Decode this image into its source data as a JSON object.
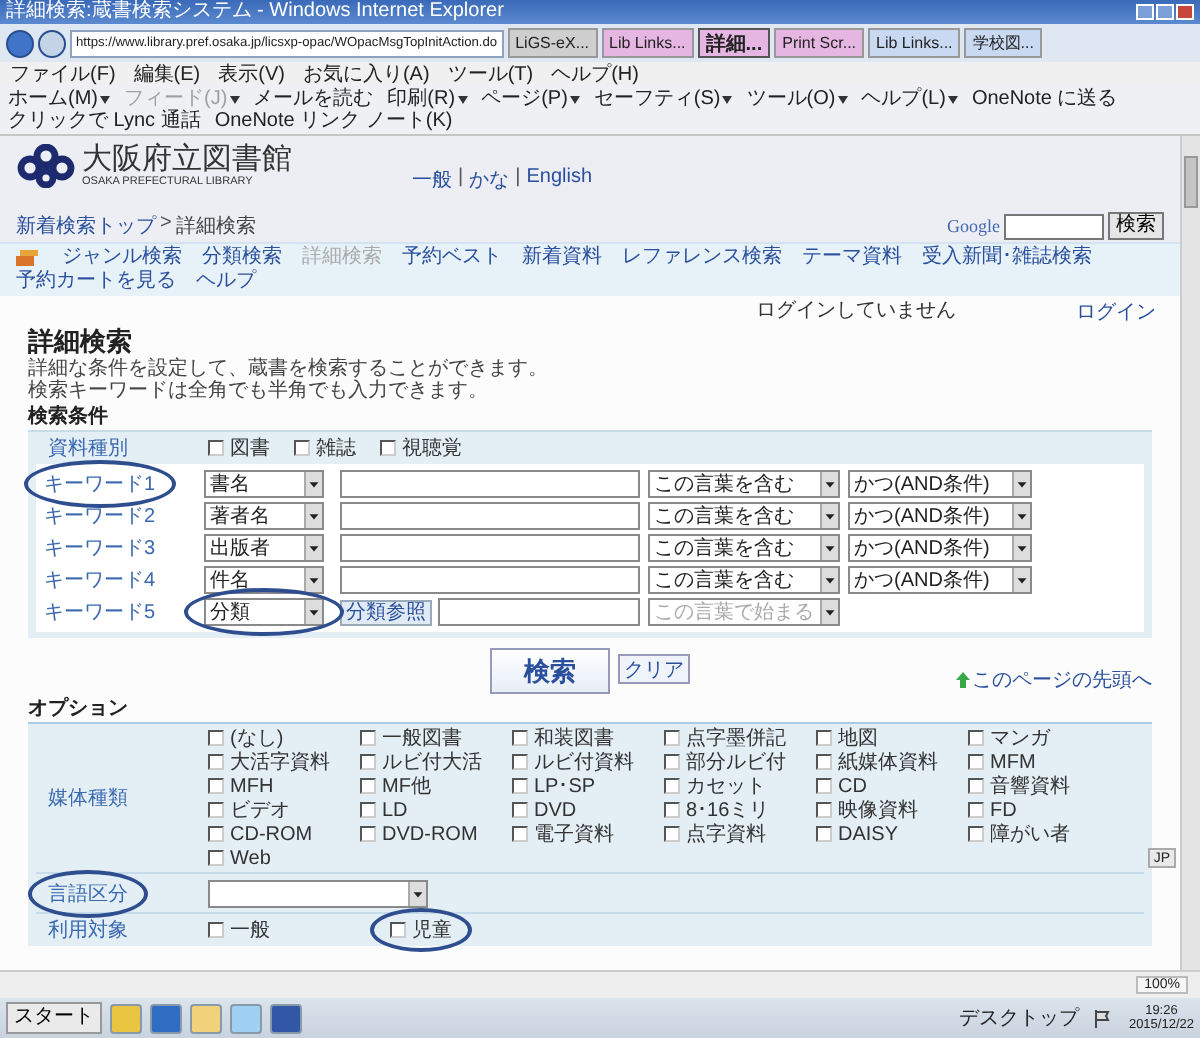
{
  "window": {
    "title": "詳細検索:蔵書検索システム - Windows Internet Explorer"
  },
  "browser": {
    "address": "https://www.library.pref.osaka.jp/licsxp-opac/WOpacMsgTopInitAction.do",
    "tabs": [
      {
        "label": "LiGS-eX...",
        "selected": false,
        "color": "#cfcfcf"
      },
      {
        "label": "Lib Links...",
        "selected": false,
        "color": "#e6b6e2"
      },
      {
        "label": "詳細...",
        "selected": true,
        "color": "#e6b6e2"
      },
      {
        "label": "Print Scr...",
        "selected": false,
        "color": "#e6b6e2"
      },
      {
        "label": "Lib Links...",
        "selected": false,
        "color": "#c9d9f2"
      },
      {
        "label": "学校図...",
        "selected": false,
        "color": "#c9d9f2"
      }
    ],
    "menu": [
      "ファイル(F)",
      "編集(E)",
      "表示(V)",
      "お気に入り(A)",
      "ツール(T)",
      "ヘルプ(H)"
    ],
    "commands": [
      {
        "label": "ホーム(M)",
        "disabled": false,
        "dropdown": true
      },
      {
        "label": "フィード(J)",
        "disabled": true,
        "dropdown": true
      },
      {
        "label": "メールを読む",
        "disabled": false,
        "dropdown": false
      },
      {
        "label": "印刷(R)",
        "disabled": false,
        "dropdown": true
      },
      {
        "label": "ページ(P)",
        "disabled": false,
        "dropdown": true
      },
      {
        "label": "セーフティ(S)",
        "disabled": false,
        "dropdown": true
      },
      {
        "label": "ツール(O)",
        "disabled": false,
        "dropdown": true
      },
      {
        "label": "ヘルプ(L)",
        "disabled": false,
        "dropdown": true
      },
      {
        "label": "OneNote に送る",
        "disabled": false,
        "dropdown": false
      },
      {
        "label": "クリックで Lync 通話",
        "disabled": false,
        "dropdown": false
      },
      {
        "label": "OneNote リンク ノート(K)",
        "disabled": false,
        "dropdown": false
      }
    ]
  },
  "header": {
    "name": "大阪府立図書館",
    "subtitle": "OSAKA PREFECTURAL LIBRARY",
    "languages": [
      "一般",
      "かな",
      "English"
    ],
    "separator": "|",
    "breadcrumb": {
      "items": [
        "新着検索トップ",
        "詳細検索"
      ],
      "separator": ">"
    },
    "google": {
      "logo": "Google",
      "button": "検索"
    }
  },
  "nav": {
    "items": [
      {
        "label": "ジャンル検索",
        "selected": false
      },
      {
        "label": "分類検索",
        "selected": false
      },
      {
        "label": "詳細検索",
        "selected": true
      },
      {
        "label": "予約ベスト",
        "selected": false
      },
      {
        "label": "新着資料",
        "selected": false
      },
      {
        "label": "レファレンス検索",
        "selected": false
      },
      {
        "label": "テーマ資料",
        "selected": false
      },
      {
        "label": "受入新聞･雑誌検索",
        "selected": false
      }
    ],
    "cart": "予約カートを見る",
    "help": "ヘルプ"
  },
  "login": {
    "status": "ログインしていません",
    "link": "ログイン"
  },
  "page": {
    "title": "詳細検索",
    "description": [
      "詳細な条件を設定して、蔵書を検索することができます。",
      "検索キーワードは全角でも半角でも入力できます。"
    ],
    "section": "検索条件"
  },
  "material_types": {
    "label": "資料種別",
    "options": [
      {
        "label": "図書",
        "checked": false
      },
      {
        "label": "雑誌",
        "checked": false
      },
      {
        "label": "視聴覚",
        "checked": false
      }
    ]
  },
  "keywords": [
    {
      "label": "キーワード1",
      "field": "書名",
      "match": "この言葉を含む",
      "disabled": false,
      "operator": "かつ(AND条件)",
      "label_circled": true,
      "field_circled": false
    },
    {
      "label": "キーワード2",
      "field": "著者名",
      "match": "この言葉を含む",
      "disabled": false,
      "operator": "かつ(AND条件)",
      "label_circled": false,
      "field_circled": false
    },
    {
      "label": "キーワード3",
      "field": "出版者",
      "match": "この言葉を含む",
      "disabled": false,
      "operator": "かつ(AND条件)",
      "label_circled": false,
      "field_circled": false
    },
    {
      "label": "キーワード4",
      "field": "件名",
      "match": "この言葉を含む",
      "disabled": false,
      "operator": "かつ(AND条件)",
      "label_circled": false,
      "field_circled": false
    },
    {
      "label": "キーワード5",
      "field": "分類",
      "reference_button": "分類参照",
      "match": "この言葉で始まる",
      "disabled": true,
      "label_circled": false,
      "field_circled": true
    }
  ],
  "actions": {
    "search": "検索",
    "clear": "クリア",
    "page_top": "このページの先頭へ"
  },
  "options": {
    "title": "オプション",
    "media": {
      "label": "媒体種類",
      "options": [
        {
          "label": "(なし)",
          "checked": false
        },
        {
          "label": "一般図書",
          "checked": false
        },
        {
          "label": "和装図書",
          "checked": false
        },
        {
          "label": "点字墨併記",
          "checked": false
        },
        {
          "label": "地図",
          "checked": false
        },
        {
          "label": "マンガ",
          "checked": false
        },
        {
          "label": "大活字資料",
          "checked": false
        },
        {
          "label": "ルビ付大活",
          "checked": false
        },
        {
          "label": "ルビ付資料",
          "checked": false
        },
        {
          "label": "部分ルビ付",
          "checked": false
        },
        {
          "label": "紙媒体資料",
          "checked": false
        },
        {
          "label": "MFM",
          "checked": false
        },
        {
          "label": "MFH",
          "checked": false
        },
        {
          "label": "MF他",
          "checked": false
        },
        {
          "label": "LP･SP",
          "checked": false
        },
        {
          "label": "カセット",
          "checked": false
        },
        {
          "label": "CD",
          "checked": false
        },
        {
          "label": "音響資料",
          "checked": false
        },
        {
          "label": "ビデオ",
          "checked": false
        },
        {
          "label": "LD",
          "checked": false
        },
        {
          "label": "DVD",
          "checked": false
        },
        {
          "label": "8･16ミリ",
          "checked": false
        },
        {
          "label": "映像資料",
          "checked": false
        },
        {
          "label": "FD",
          "checked": false
        },
        {
          "label": "CD-ROM",
          "checked": false
        },
        {
          "label": "DVD-ROM",
          "checked": false
        },
        {
          "label": "電子資料",
          "checked": false
        },
        {
          "label": "点字資料",
          "checked": false
        },
        {
          "label": "DAISY",
          "checked": false
        },
        {
          "label": "障がい者",
          "checked": false
        },
        {
          "label": "Web",
          "checked": false
        }
      ]
    },
    "language": {
      "label": "言語区分",
      "circled": true
    },
    "audience": {
      "label": "利用対象",
      "options": [
        {
          "label": "一般",
          "checked": false,
          "circled": false
        },
        {
          "label": "児童",
          "checked": false,
          "circled": true
        }
      ]
    }
  },
  "language_bar": {
    "label": "JP"
  },
  "status_bar": {
    "zoom": "100%"
  },
  "taskbar": {
    "start": "スタート",
    "desktop": "デスクトップ",
    "time": "19:26",
    "date": "2015/12/22"
  }
}
